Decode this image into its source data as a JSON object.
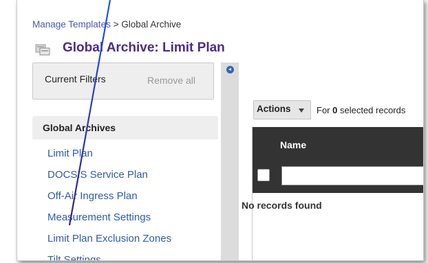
{
  "breadcrumb": {
    "link": "Manage Templates",
    "separator": ">",
    "current": "Global Archive"
  },
  "page": {
    "title": "Global Archive: Limit Plan"
  },
  "filters": {
    "label": "Current Filters",
    "remove_all": "Remove all"
  },
  "nav": {
    "header": "Global Archives",
    "items": [
      {
        "label": "Limit Plan"
      },
      {
        "label": "DOCSIS Service Plan"
      },
      {
        "label": "Off-Air Ingress Plan"
      },
      {
        "label": "Measurement Settings"
      },
      {
        "label": "Limit Plan Exclusion Zones"
      },
      {
        "label": "Tilt Settings"
      }
    ]
  },
  "toolbar": {
    "actions_label": "Actions",
    "for_prefix": "For",
    "selected_count": "0",
    "selected_suffix": "selected records"
  },
  "grid": {
    "column_name": "Name",
    "filter_value": "",
    "empty_message": "No records found"
  },
  "colors": {
    "title": "#4b2a8f",
    "link": "#2e5ba8",
    "header_bg": "#333333",
    "annotation_arrow": "#1f4fd6"
  },
  "icons": {
    "title_icon": "archive-icon",
    "collapse": "chevron-left-icon",
    "dropdown": "caret-down-icon"
  }
}
